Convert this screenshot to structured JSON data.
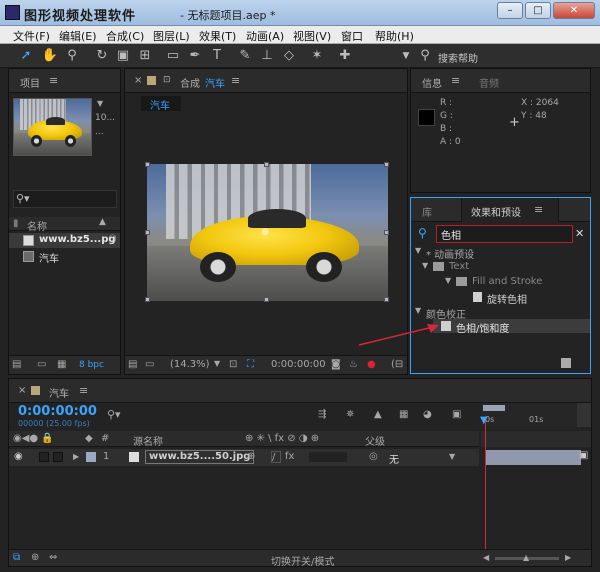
{
  "window": {
    "title": "图形视频处理软件",
    "document": "- 无标题项目.aep *",
    "minimize": "–",
    "maximize": "□",
    "close": "✕"
  },
  "menu": [
    "文件(F)",
    "编辑(E)",
    "合成(C)",
    "图层(L)",
    "效果(T)",
    "动画(A)",
    "视图(V)",
    "窗口",
    "帮助(H)"
  ],
  "toolbar": {
    "search_help": "搜索帮助"
  },
  "project": {
    "tab": "项目",
    "thumb_meta1": "▼",
    "thumb_meta2": "10...",
    "search_icon": "🔍",
    "column_name": "名称",
    "items": [
      {
        "name": "www.bz5...pg"
      },
      {
        "name": "汽车"
      }
    ],
    "bpc": "8 bpc"
  },
  "composition": {
    "close": "×",
    "lock": "🔒",
    "tab_prefix": "合成",
    "tab_name": "汽车",
    "breadcrumb": "汽车",
    "zoom": "(14.3%)",
    "timecode": "0:00:00:00"
  },
  "info": {
    "tab": "信息",
    "tab2": "音频",
    "r": "R :",
    "g": "G :",
    "b": "B :",
    "a": "A : 0",
    "x": "X : 2064",
    "y": "Y : 48"
  },
  "effects": {
    "tab_library": "库",
    "tab_effects": "效果和预设",
    "search_value": "色相",
    "tree": [
      "* 动画预设",
      "Text",
      "Fill and Stroke",
      "旋转色相",
      "颜色校正",
      "色相/饱和度"
    ]
  },
  "timeline": {
    "tab": "汽车",
    "timecode": "0:00:00:00",
    "fps": "00000 (25.00 fps)",
    "col_source": "源名称",
    "col_parent": "父级",
    "ruler_0": "0s",
    "ruler_1": "01s",
    "layer_index": "1",
    "layer_name": "www.bz5....50.jpg",
    "parent_value": "无",
    "footer": "切换开关/模式"
  },
  "colors": {
    "accent": "#3aa3ff",
    "search_border": "#b3202e",
    "arrow": "#d9263a"
  }
}
